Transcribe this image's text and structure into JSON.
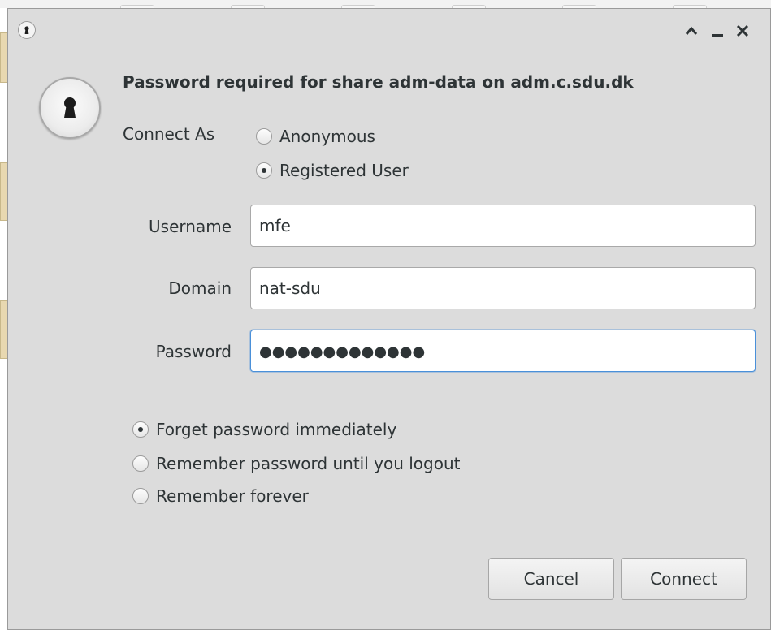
{
  "dialog": {
    "title_controls": {
      "maximize": "^",
      "minimize": "_",
      "close": "✕"
    },
    "heading": "Password required for share adm-data on adm.c.sdu.dk",
    "connect_as": {
      "label": "Connect As",
      "options": [
        {
          "label": "Anonymous",
          "checked": false
        },
        {
          "label": "Registered User",
          "checked": true
        }
      ]
    },
    "fields": {
      "username": {
        "label": "Username",
        "value": "mfe"
      },
      "domain": {
        "label": "Domain",
        "value": "nat-sdu"
      },
      "password": {
        "label": "Password",
        "value": "●●●●●●●●●●●●●"
      }
    },
    "remember": {
      "options": [
        {
          "label": "Forget password immediately",
          "checked": true
        },
        {
          "label": "Remember password until you logout",
          "checked": false
        },
        {
          "label": "Remember forever",
          "checked": false
        }
      ]
    },
    "buttons": {
      "cancel": "Cancel",
      "connect": "Connect"
    }
  },
  "icons": {
    "titlebar": "keyhole-icon",
    "main": "lock-keyhole-icon"
  }
}
